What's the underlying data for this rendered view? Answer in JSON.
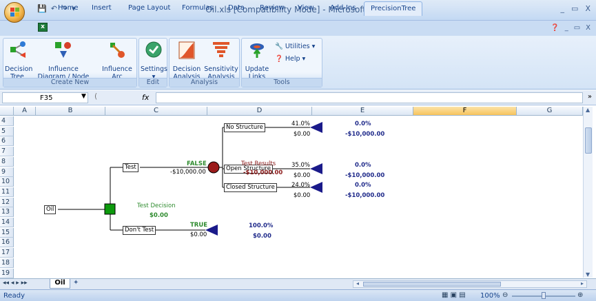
{
  "window": {
    "title": "Oil.xls  [Compatibility Mode] - Microsoft Excel",
    "controls": [
      "_",
      "▭",
      "X"
    ]
  },
  "qat": {
    "save": "💾",
    "undo": "↶",
    "redo": "↷",
    "custom": "▾"
  },
  "tabs": [
    "Home",
    "Insert",
    "Page Layout",
    "Formulas",
    "Data",
    "Review",
    "View",
    "Add-Ins",
    "PrecisionTree"
  ],
  "ribbon": {
    "create_new": {
      "label": "Create New",
      "decision_tree": [
        "Decision",
        "Tree"
      ],
      "influence_node": [
        "Influence",
        "Diagram / Node"
      ],
      "influence_arc": [
        "Influence",
        "Arc"
      ]
    },
    "edit": {
      "label": "Edit",
      "settings": "Settings"
    },
    "analysis": {
      "label": "Analysis",
      "decision_analysis": [
        "Decision",
        "Analysis ▾"
      ],
      "sensitivity_analysis": [
        "Sensitivity",
        "Analysis"
      ]
    },
    "tools": {
      "label": "Tools",
      "update_links": [
        "Update",
        "Links"
      ],
      "utilities": "Utilities ▾",
      "help": "Help ▾"
    }
  },
  "formula": {
    "name_box": "F35",
    "fx": "fx",
    "value": ""
  },
  "columns": [
    "A",
    "B",
    "C",
    "D",
    "E",
    "F",
    "G"
  ],
  "selected_column": "F",
  "rows": [
    "4",
    "5",
    "6",
    "7",
    "8",
    "9",
    "10",
    "11",
    "12",
    "13",
    "14",
    "15",
    "16",
    "17",
    "18",
    "19"
  ],
  "tree": {
    "root": "Oil",
    "decision_name": "Test Decision",
    "decision_value": "$0.00",
    "test": {
      "label": "Test",
      "flag": "FALSE",
      "cost": "-$10,000.00"
    },
    "dont_test": {
      "label": "Don't Test",
      "flag": "TRUE",
      "cost": "$0.00",
      "prob": "100.0%",
      "value": "$0.00"
    },
    "chance": {
      "name": "Test Results",
      "value": "-$10,000.00"
    },
    "branches": [
      {
        "label": "No Structure",
        "prob": "41.0%",
        "payoff": "$0.00",
        "p2": "0.0%",
        "v2": "-$10,000.00"
      },
      {
        "label": "Open Structure",
        "prob": "35.0%",
        "payoff": "$0.00",
        "p2": "0.0%",
        "v2": "-$10,000.00"
      },
      {
        "label": "Closed Structure",
        "prob": "24.0%",
        "payoff": "$0.00",
        "p2": "0.0%",
        "v2": "-$10,000.00"
      }
    ]
  },
  "sheet": {
    "active_tab": "Oil"
  },
  "status": {
    "ready": "Ready",
    "zoom": "100%"
  },
  "colors": {
    "decision": "#0d9a0d",
    "chance": "#9b1b1b",
    "terminal": "#1a1a8a"
  }
}
